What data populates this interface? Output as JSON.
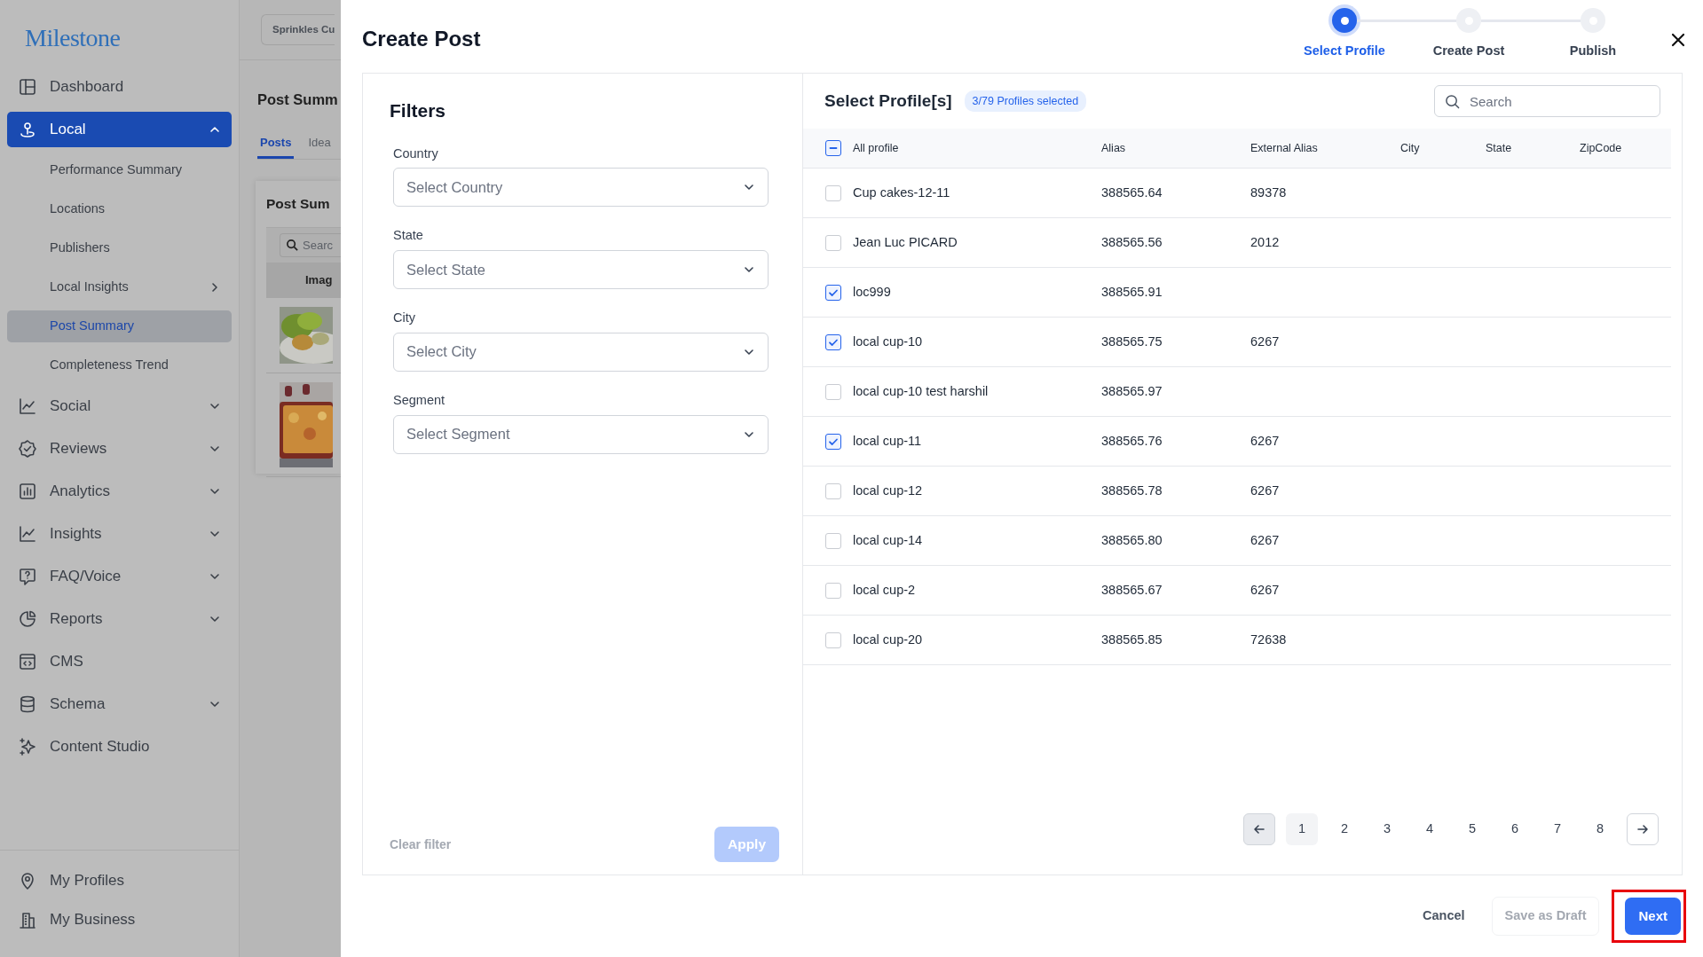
{
  "sidebar": {
    "logo": "Milestone",
    "items": [
      {
        "label": "Dashboard",
        "kind": "link",
        "selected": false
      },
      {
        "label": "Local",
        "kind": "group",
        "selected": true,
        "expanded": true,
        "children": [
          {
            "label": "Performance Summary",
            "kind": "link",
            "selected": false
          },
          {
            "label": "Locations",
            "kind": "link",
            "selected": false
          },
          {
            "label": "Publishers",
            "kind": "link",
            "selected": false
          },
          {
            "label": "Local Insights",
            "kind": "submenu",
            "selected": false
          },
          {
            "label": "Post Summary",
            "kind": "link",
            "selected": true
          },
          {
            "label": "Completeness Trend",
            "kind": "link",
            "selected": false
          }
        ]
      },
      {
        "label": "Social",
        "kind": "group",
        "selected": false,
        "expanded": false
      },
      {
        "label": "Reviews",
        "kind": "group",
        "selected": false,
        "expanded": false
      },
      {
        "label": "Analytics",
        "kind": "group",
        "selected": false,
        "expanded": false
      },
      {
        "label": "Insights",
        "kind": "group",
        "selected": false,
        "expanded": false
      },
      {
        "label": "FAQ/Voice",
        "kind": "group",
        "selected": false,
        "expanded": false
      },
      {
        "label": "Reports",
        "kind": "group",
        "selected": false,
        "expanded": false
      },
      {
        "label": "CMS",
        "kind": "link",
        "selected": false
      },
      {
        "label": "Schema",
        "kind": "group",
        "selected": false,
        "expanded": false
      },
      {
        "label": "Content Studio",
        "kind": "link",
        "selected": false
      }
    ],
    "bottom_items": [
      {
        "label": "My Profiles",
        "kind": "link",
        "selected": false
      },
      {
        "label": "My Business",
        "kind": "link",
        "selected": false
      }
    ]
  },
  "background_page": {
    "account_button": "Sprinkles Cu",
    "title": "Post Summ",
    "tabs": [
      {
        "label": "Posts",
        "selected": true
      },
      {
        "label": "Idea",
        "selected": false
      }
    ],
    "card": {
      "title": "Post Sum",
      "search": {
        "placeholder": "Searc"
      },
      "column_1": "Imag"
    }
  },
  "modal": {
    "title": "Create Post",
    "steps": [
      {
        "label": "Select Profile",
        "selected": true
      },
      {
        "label": "Create Post",
        "selected": false
      },
      {
        "label": "Publish",
        "selected": false
      }
    ],
    "filters": {
      "title": "Filters",
      "fields": [
        {
          "label": "Country",
          "placeholder": "Select Country"
        },
        {
          "label": "State",
          "placeholder": "Select State"
        },
        {
          "label": "City",
          "placeholder": "Select City"
        },
        {
          "label": "Segment",
          "placeholder": "Select Segment"
        }
      ],
      "clear_filter": {
        "label": "Clear filter",
        "disabled": true
      },
      "apply": {
        "label": "Apply",
        "disabled": true
      }
    },
    "profiles": {
      "title": "Select Profile[s]",
      "badge": "3/79 Profiles selected",
      "search": {
        "placeholder": "Search"
      },
      "select_all": {
        "indeterminate": true
      },
      "columns": [
        "All profile",
        "Alias",
        "External Alias",
        "City",
        "State",
        "ZipCode"
      ],
      "rows": [
        {
          "name": "Cup cakes-12-11",
          "alias": "388565.64",
          "external_alias": "89378",
          "checked": false
        },
        {
          "name": "Jean Luc PICARD",
          "alias": "388565.56",
          "external_alias": "2012",
          "checked": false
        },
        {
          "name": "loc999",
          "alias": "388565.91",
          "checked": true
        },
        {
          "name": "local cup-10",
          "alias": "388565.75",
          "external_alias": "6267",
          "checked": true
        },
        {
          "name": "local cup-10 test harshil",
          "alias": "388565.97",
          "checked": false
        },
        {
          "name": "local cup-11",
          "alias": "388565.76",
          "external_alias": "6267",
          "checked": true
        },
        {
          "name": "local cup-12",
          "alias": "388565.78",
          "external_alias": "6267",
          "checked": false
        },
        {
          "name": "local cup-14",
          "alias": "388565.80",
          "external_alias": "6267",
          "checked": false
        },
        {
          "name": "local cup-2",
          "alias": "388565.67",
          "external_alias": "6267",
          "checked": false
        },
        {
          "name": "local cup-20",
          "alias": "388565.85",
          "external_alias": "72638",
          "checked": false
        }
      ],
      "pagination": {
        "prev_disabled": true,
        "next_disabled": false,
        "pages": [
          {
            "label": "1",
            "selected": true
          },
          {
            "label": "2",
            "selected": false
          },
          {
            "label": "3",
            "selected": false
          },
          {
            "label": "4",
            "selected": false
          },
          {
            "label": "5",
            "selected": false
          },
          {
            "label": "6",
            "selected": false
          },
          {
            "label": "7",
            "selected": false
          },
          {
            "label": "8",
            "selected": false
          }
        ]
      }
    },
    "footer": [
      {
        "label": "Cancel",
        "kind": "text",
        "disabled": false,
        "highlighted": false
      },
      {
        "label": "Save as Draft",
        "kind": "outline",
        "disabled": true,
        "highlighted": false
      },
      {
        "label": "Next",
        "kind": "primary",
        "disabled": false,
        "highlighted": true
      }
    ]
  }
}
